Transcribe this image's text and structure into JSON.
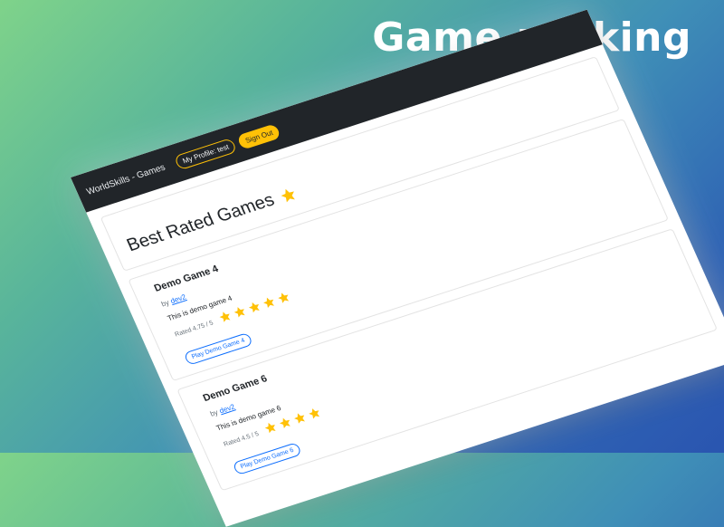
{
  "banner": {
    "title": "Game ranking"
  },
  "app": {
    "brand": "WorldSkills - Games",
    "nav": {
      "profile_label": "My Profile: test",
      "signout_label": "Sign Out"
    },
    "page_title": "Best Rated Games",
    "games": [
      {
        "title": "Demo Game 4",
        "author_prefix": "by",
        "author": "dev2",
        "description": "This is demo game 4",
        "rating_text": "Rated 4.75 / 5",
        "stars": 5,
        "play_label": "Play Demo Game 4"
      },
      {
        "title": "Demo Game 6",
        "author_prefix": "by",
        "author": "dev2",
        "description": "This is demo game 6",
        "rating_text": "Rated 4.5 / 5",
        "stars": 4,
        "play_label": "Play Demo Game 6"
      }
    ]
  },
  "colors": {
    "star": "#ffc107",
    "navbar": "#212529",
    "link": "#0d6efd"
  },
  "icons": {
    "star": "star-icon"
  }
}
